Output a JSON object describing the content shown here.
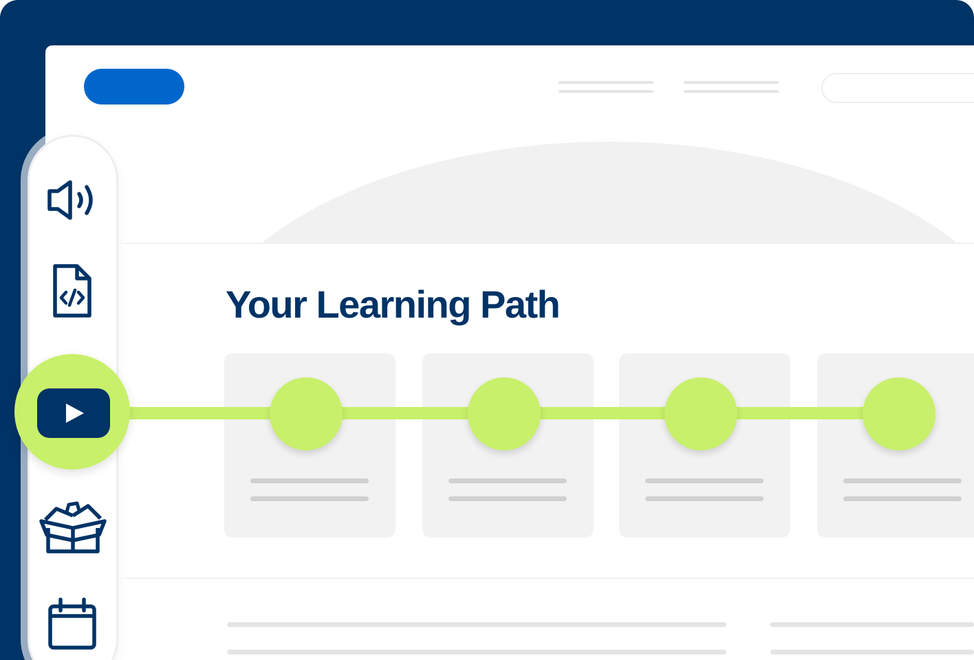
{
  "page": {
    "title": "Your Learning Path"
  },
  "sidebar": {
    "items": [
      {
        "icon": "megaphone-icon"
      },
      {
        "icon": "code-file-icon"
      },
      {
        "icon": "play-icon",
        "active": true
      },
      {
        "icon": "gift-box-icon"
      },
      {
        "icon": "calendar-icon"
      }
    ]
  },
  "timeline": {
    "steps": 4
  },
  "colors": {
    "frame": "#003366",
    "brand_blue": "#0066cc",
    "accent_green": "#c8f06a",
    "card_bg": "#f2f2f2",
    "title": "#003366"
  }
}
